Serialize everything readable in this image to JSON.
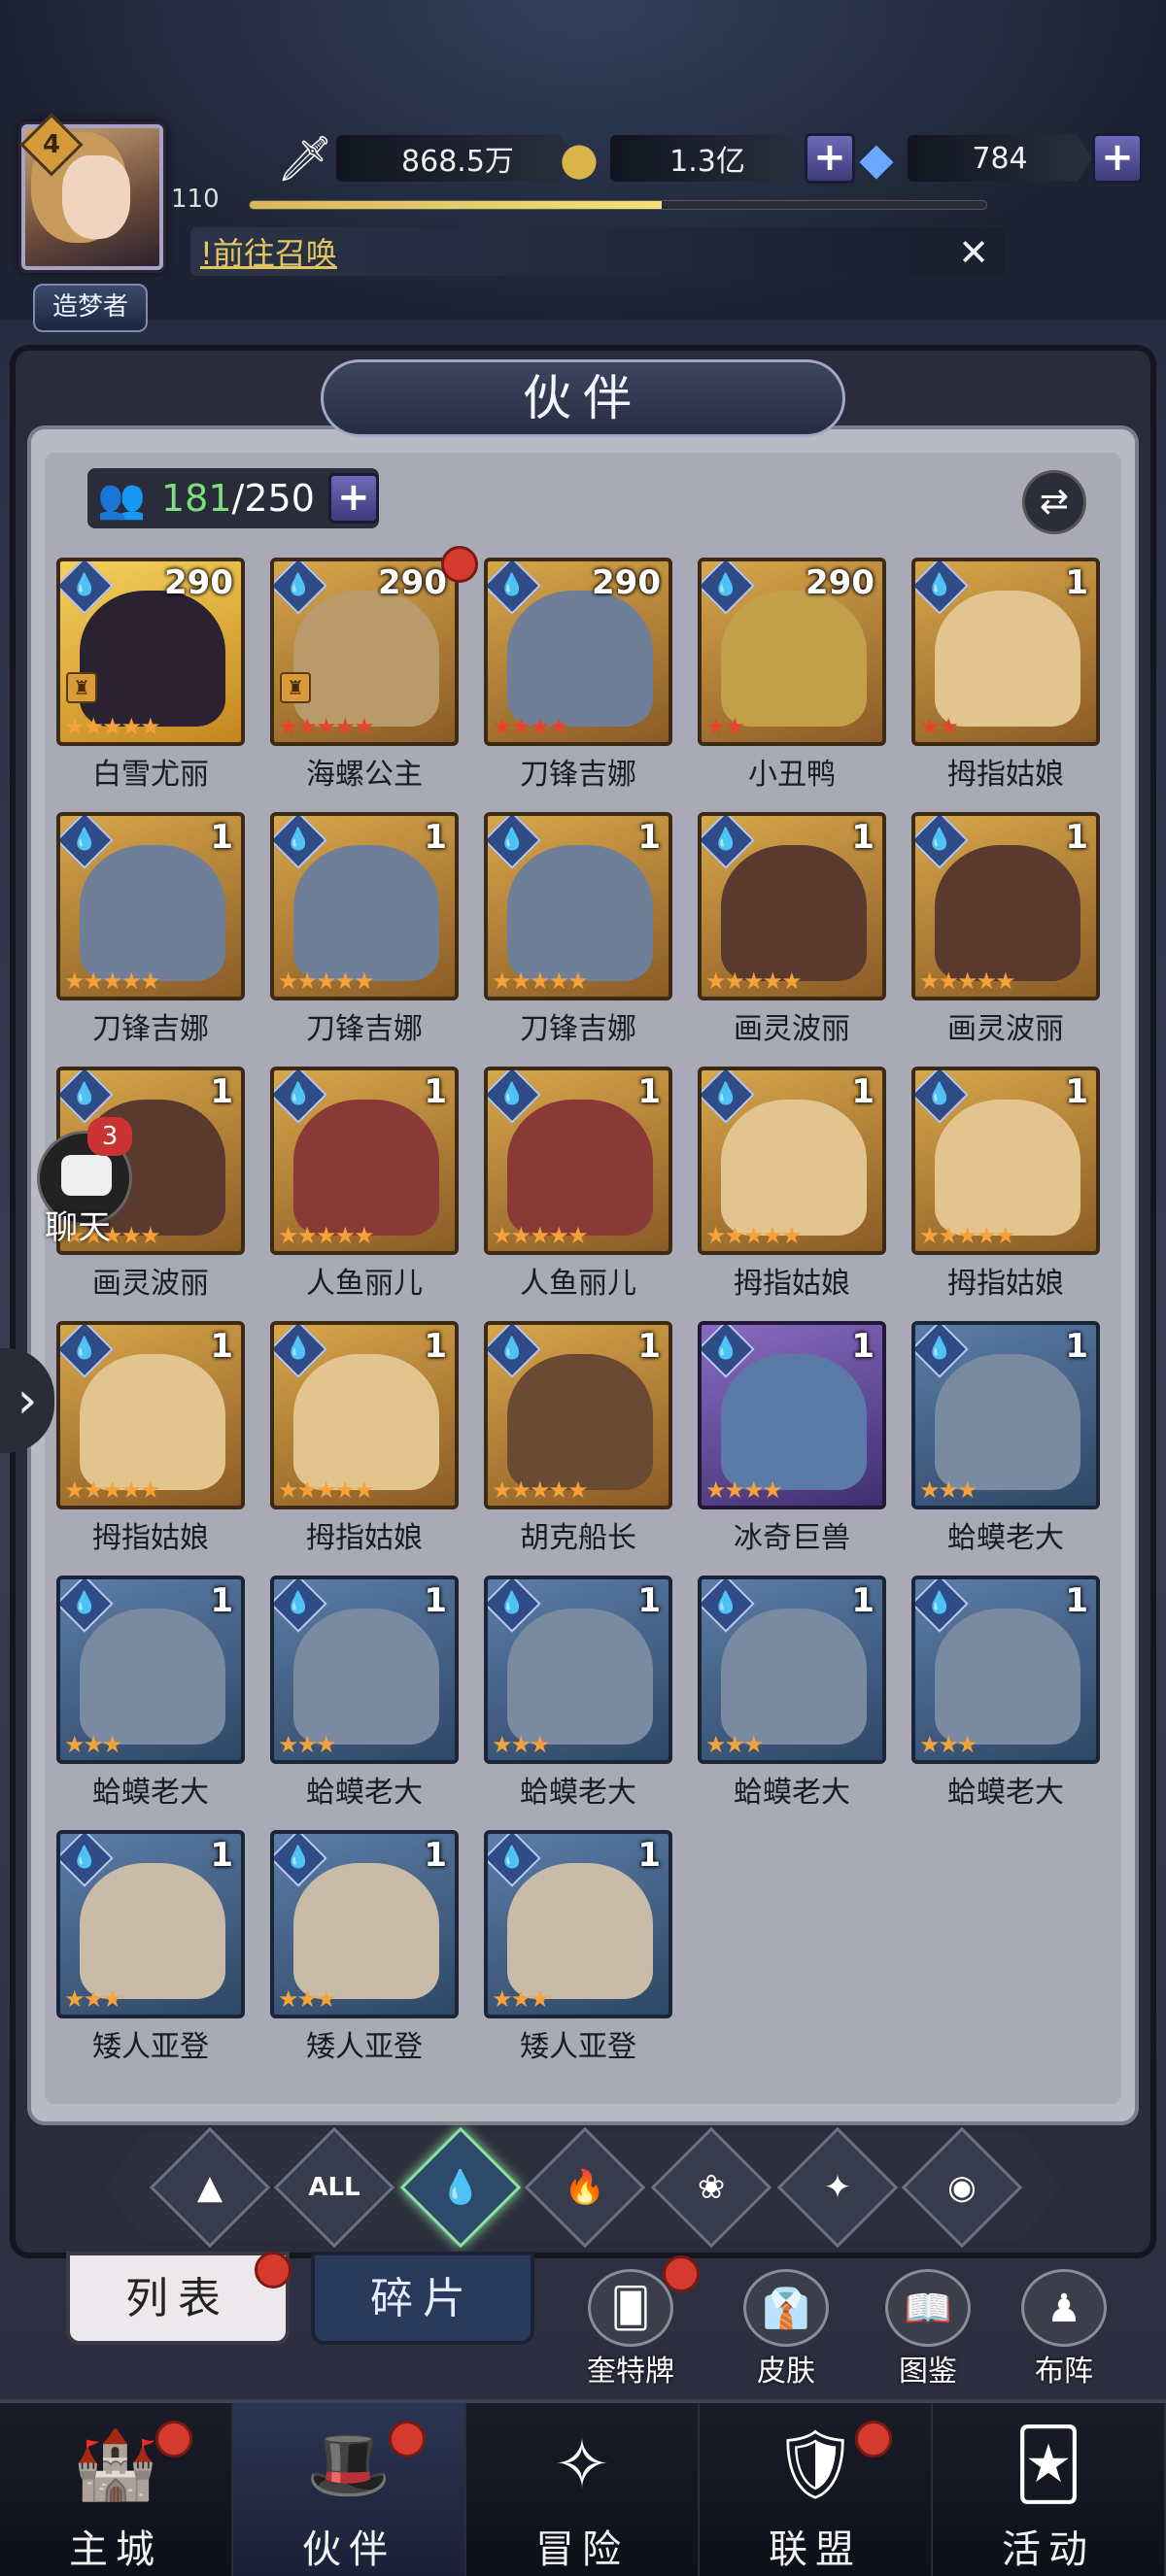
{
  "player": {
    "level": "4",
    "exp_level": "110",
    "exp_fraction": 0.56,
    "title": "造梦者"
  },
  "resources": {
    "power": "868.5万",
    "gold": "1.3亿",
    "diamonds": "784"
  },
  "notice": {
    "text": "!前往召唤"
  },
  "panel": {
    "title": "伙伴",
    "count_current": "181",
    "count_total": "/250"
  },
  "partners": [
    {
      "name": "白雪尤丽",
      "level": "290",
      "stars": "★★★★★",
      "star_color": "orange",
      "frame": "gold-special",
      "art": "#2a2230",
      "rank": true,
      "dot": false
    },
    {
      "name": "海螺公主",
      "level": "290",
      "stars": "★★★★★",
      "star_color": "red",
      "frame": "gold",
      "art": "#b99a6a",
      "rank": true,
      "dot": true
    },
    {
      "name": "刀锋吉娜",
      "level": "290",
      "stars": "★★★★",
      "star_color": "red",
      "frame": "gold",
      "art": "#6f7f98",
      "rank": false,
      "dot": false
    },
    {
      "name": "小丑鸭",
      "level": "290",
      "stars": "★★",
      "star_color": "red",
      "frame": "gold",
      "art": "#c2a04a",
      "rank": false,
      "dot": false
    },
    {
      "name": "拇指姑娘",
      "level": "1",
      "stars": "★★",
      "star_color": "red",
      "frame": "gold",
      "art": "#e2c48e",
      "rank": false,
      "dot": false
    },
    {
      "name": "刀锋吉娜",
      "level": "1",
      "stars": "★★★★★",
      "star_color": "orange",
      "frame": "gold",
      "art": "#6f7f98",
      "rank": false,
      "dot": false
    },
    {
      "name": "刀锋吉娜",
      "level": "1",
      "stars": "★★★★★",
      "star_color": "orange",
      "frame": "gold",
      "art": "#6f7f98",
      "rank": false,
      "dot": false
    },
    {
      "name": "刀锋吉娜",
      "level": "1",
      "stars": "★★★★★",
      "star_color": "orange",
      "frame": "gold",
      "art": "#6f7f98",
      "rank": false,
      "dot": false
    },
    {
      "name": "画灵波丽",
      "level": "1",
      "stars": "★★★★★",
      "star_color": "orange",
      "frame": "gold",
      "art": "#5a3a2e",
      "rank": false,
      "dot": false
    },
    {
      "name": "画灵波丽",
      "level": "1",
      "stars": "★★★★★",
      "star_color": "orange",
      "frame": "gold",
      "art": "#5a3a2e",
      "rank": false,
      "dot": false
    },
    {
      "name": "画灵波丽",
      "level": "1",
      "stars": "★★★★★",
      "star_color": "orange",
      "frame": "gold",
      "art": "#5a3a2e",
      "rank": false,
      "dot": false
    },
    {
      "name": "人鱼丽儿",
      "level": "1",
      "stars": "★★★★★",
      "star_color": "orange",
      "frame": "gold",
      "art": "#8a3a36",
      "rank": false,
      "dot": false
    },
    {
      "name": "人鱼丽儿",
      "level": "1",
      "stars": "★★★★★",
      "star_color": "orange",
      "frame": "gold",
      "art": "#8a3a36",
      "rank": false,
      "dot": false
    },
    {
      "name": "拇指姑娘",
      "level": "1",
      "stars": "★★★★★",
      "star_color": "orange",
      "frame": "gold",
      "art": "#e2c48e",
      "rank": false,
      "dot": false
    },
    {
      "name": "拇指姑娘",
      "level": "1",
      "stars": "★★★★★",
      "star_color": "orange",
      "frame": "gold",
      "art": "#e2c48e",
      "rank": false,
      "dot": false
    },
    {
      "name": "拇指姑娘",
      "level": "1",
      "stars": "★★★★★",
      "star_color": "orange",
      "frame": "gold",
      "art": "#e2c48e",
      "rank": false,
      "dot": false
    },
    {
      "name": "拇指姑娘",
      "level": "1",
      "stars": "★★★★★",
      "star_color": "orange",
      "frame": "gold",
      "art": "#e2c48e",
      "rank": false,
      "dot": false
    },
    {
      "name": "胡克船长",
      "level": "1",
      "stars": "★★★★★",
      "star_color": "orange",
      "frame": "gold",
      "art": "#6a4a32",
      "rank": false,
      "dot": false
    },
    {
      "name": "冰奇巨兽",
      "level": "1",
      "stars": "★★★★",
      "star_color": "orange",
      "frame": "purple",
      "art": "#5a7aa8",
      "rank": false,
      "dot": false
    },
    {
      "name": "蛤蟆老大",
      "level": "1",
      "stars": "★★★",
      "star_color": "orange",
      "frame": "blue",
      "art": "#7a8aa0",
      "rank": false,
      "dot": false
    },
    {
      "name": "蛤蟆老大",
      "level": "1",
      "stars": "★★★",
      "star_color": "orange",
      "frame": "blue",
      "art": "#7a8aa0",
      "rank": false,
      "dot": false
    },
    {
      "name": "蛤蟆老大",
      "level": "1",
      "stars": "★★★",
      "star_color": "orange",
      "frame": "blue",
      "art": "#7a8aa0",
      "rank": false,
      "dot": false
    },
    {
      "name": "蛤蟆老大",
      "level": "1",
      "stars": "★★★",
      "star_color": "orange",
      "frame": "blue",
      "art": "#7a8aa0",
      "rank": false,
      "dot": false
    },
    {
      "name": "蛤蟆老大",
      "level": "1",
      "stars": "★★★",
      "star_color": "orange",
      "frame": "blue",
      "art": "#7a8aa0",
      "rank": false,
      "dot": false
    },
    {
      "name": "蛤蟆老大",
      "level": "1",
      "stars": "★★★",
      "star_color": "orange",
      "frame": "blue",
      "art": "#7a8aa0",
      "rank": false,
      "dot": false
    },
    {
      "name": "矮人亚登",
      "level": "1",
      "stars": "★★★",
      "star_color": "orange",
      "frame": "blue",
      "art": "#c8bca8",
      "rank": false,
      "dot": false
    },
    {
      "name": "矮人亚登",
      "level": "1",
      "stars": "★★★",
      "star_color": "orange",
      "frame": "blue",
      "art": "#c8bca8",
      "rank": false,
      "dot": false
    },
    {
      "name": "矮人亚登",
      "level": "1",
      "stars": "★★★",
      "star_color": "orange",
      "frame": "blue",
      "art": "#c8bca8",
      "rank": false,
      "dot": false
    }
  ],
  "chat": {
    "label": "聊天",
    "badge": "3"
  },
  "filters": [
    {
      "icon": "▲",
      "name": "filter-light-icon",
      "active": false
    },
    {
      "icon": "ALL",
      "name": "filter-all-icon",
      "active": false
    },
    {
      "icon": "💧",
      "name": "filter-water-icon",
      "active": true
    },
    {
      "icon": "🔥",
      "name": "filter-fire-icon",
      "active": false
    },
    {
      "icon": "❀",
      "name": "filter-wind-icon",
      "active": false
    },
    {
      "icon": "✦",
      "name": "filter-star-icon",
      "active": false
    },
    {
      "icon": "◉",
      "name": "filter-dark-icon",
      "active": false
    }
  ],
  "subtabs": {
    "list": "列表",
    "fragments": "碎片"
  },
  "tools": [
    {
      "label": "奎特牌",
      "icon": "🂠",
      "dot": true
    },
    {
      "label": "皮肤",
      "icon": "👔",
      "dot": false
    },
    {
      "label": "图鉴",
      "icon": "📖",
      "dot": false
    },
    {
      "label": "布阵",
      "icon": "♟",
      "dot": false
    }
  ],
  "nav": [
    {
      "label": "主城",
      "icon": "🏰",
      "dot": true,
      "active": false
    },
    {
      "label": "伙伴",
      "icon": "🎩",
      "dot": true,
      "active": true
    },
    {
      "label": "冒险",
      "icon": "✧",
      "dot": false,
      "active": false
    },
    {
      "label": "联盟",
      "icon": "🛡",
      "dot": true,
      "active": false
    },
    {
      "label": "活动",
      "icon": "🃏",
      "dot": false,
      "active": false
    }
  ]
}
